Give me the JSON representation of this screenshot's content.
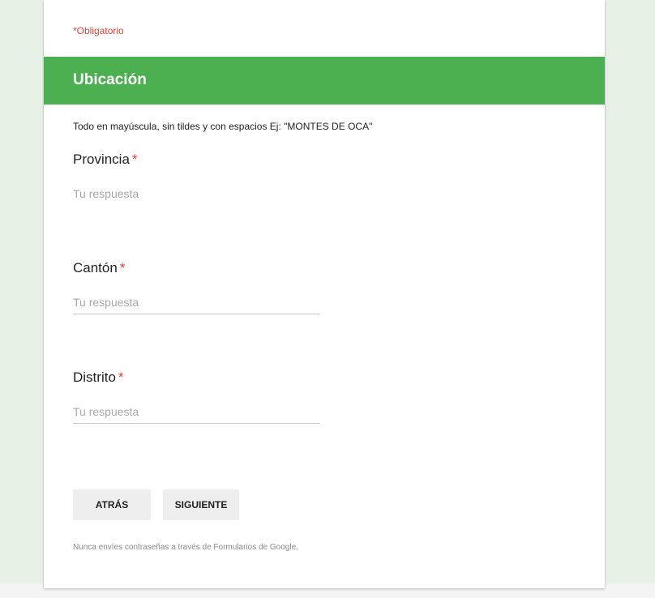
{
  "form": {
    "required_note": "*Obligatorio",
    "section": {
      "title": "Ubicación",
      "description": "Todo en mayúscula, sin tildes y con espacios  Ej: \"MONTES DE OCA\""
    },
    "questions": [
      {
        "label": "Provincia",
        "required_mark": "*",
        "placeholder": "Tu respuesta"
      },
      {
        "label": "Cantón",
        "required_mark": "*",
        "placeholder": "Tu respuesta"
      },
      {
        "label": "Distrito",
        "required_mark": "*",
        "placeholder": "Tu respuesta"
      }
    ],
    "buttons": {
      "back_label": "ATRÁS",
      "next_label": "SIGUIENTE"
    },
    "footer_note": "Nunca envíes contraseñas a través de Formularios de Google."
  },
  "colors": {
    "header_green": "#4caf50",
    "page_background": "#e6f2e6",
    "required_red": "#db4437"
  }
}
